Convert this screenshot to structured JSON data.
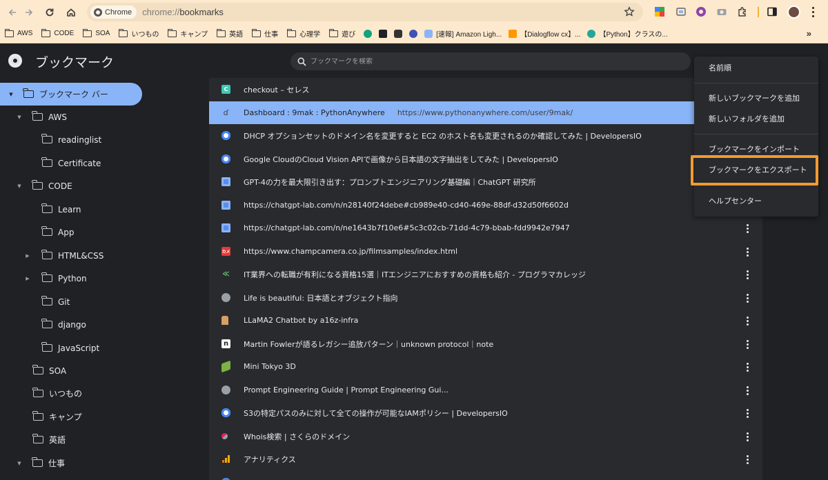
{
  "browser": {
    "chip_label": "Chrome",
    "url_scheme": "chrome://",
    "url_path": "bookmarks"
  },
  "bookmarks_bar": {
    "folders": [
      "AWS",
      "CODE",
      "SOA",
      "いつもの",
      "キャンプ",
      "英語",
      "仕事",
      "心理学",
      "遊び"
    ],
    "links": [
      "[速報] Amazon Ligh...",
      "【Dialogflow cx】...",
      "【Python】クラスの..."
    ],
    "overflow": "»"
  },
  "manager": {
    "title": "ブックマーク",
    "search_placeholder": "ブックマークを検索"
  },
  "sidebar": {
    "items": [
      {
        "label": "ブックマーク バー",
        "arrow": "▼",
        "selected": true
      },
      {
        "label": "AWS",
        "arrow": "▼"
      },
      {
        "label": "readinglist",
        "arrow": ""
      },
      {
        "label": "Certificate",
        "arrow": ""
      },
      {
        "label": "CODE",
        "arrow": "▼"
      },
      {
        "label": "Learn",
        "arrow": ""
      },
      {
        "label": "App",
        "arrow": ""
      },
      {
        "label": "HTML&CSS",
        "arrow": "▶"
      },
      {
        "label": "Python",
        "arrow": "▶"
      },
      {
        "label": "Git",
        "arrow": ""
      },
      {
        "label": "django",
        "arrow": ""
      },
      {
        "label": "JavaScript",
        "arrow": ""
      },
      {
        "label": "SOA",
        "arrow": ""
      },
      {
        "label": "いつもの",
        "arrow": ""
      },
      {
        "label": "キャンプ",
        "arrow": ""
      },
      {
        "label": "英語",
        "arrow": ""
      },
      {
        "label": "仕事",
        "arrow": "▼"
      }
    ]
  },
  "list": {
    "rows": [
      {
        "title": "checkout – セレス",
        "url": "",
        "icon": "C",
        "icon_color": "#3fc8b5",
        "selected": false
      },
      {
        "title": "Dashboard : 9mak : PythonAnywhere",
        "url": "https://www.pythonanywhere.com/user/9mak/",
        "icon": "ɗ",
        "icon_color": "#8ab4f8",
        "selected": true
      },
      {
        "title": "DHCP オプションセットのドメイン名を変更すると EC2 のホスト名も変更されるのか確認してみた | DevelopersIO",
        "url": "",
        "icon": "",
        "icon_color": "#ffffff",
        "selected": false
      },
      {
        "title": "Google CloudのCloud Vision APIで画像から日本語の文字抽出をしてみた | DevelopersIO",
        "url": "",
        "icon": "",
        "icon_color": "#ffffff",
        "selected": false
      },
      {
        "title": "GPT-4の力を最大限引き出す：プロンプトエンジニアリング基礎編｜ChatGPT 研究所",
        "url": "",
        "icon": "",
        "icon_color": "#5b8def",
        "selected": false
      },
      {
        "title": "https://chatgpt-lab.com/n/n28140f24debe#cb989e40-cd40-469e-88df-d32d50f6602d",
        "url": "",
        "icon": "",
        "icon_color": "#5b8def",
        "selected": false
      },
      {
        "title": "https://chatgpt-lab.com/n/ne1643b7f10e6#5c3c02cb-71dd-4c79-bbab-fdd9942e7947",
        "url": "",
        "icon": "",
        "icon_color": "#5b8def",
        "selected": false
      },
      {
        "title": "https://www.champcamera.co.jp/filmsamples/index.html",
        "url": "",
        "icon": "カメ",
        "icon_color": "#e53935",
        "selected": false
      },
      {
        "title": "IT業界への転職が有利になる資格15選｜ITエンジニアにおすすめの資格も紹介 - プログラマカレッジ",
        "url": "",
        "icon": "≪",
        "icon_color": "#2e7d32",
        "selected": false
      },
      {
        "title": "Life is beautiful: 日本語とオブジェクト指向",
        "url": "",
        "icon": "",
        "icon_color": "#9aa0a6",
        "selected": false
      },
      {
        "title": "LLaMA2 Chatbot by a16z-infra",
        "url": "",
        "icon": "",
        "icon_color": "#d9a066",
        "selected": false
      },
      {
        "title": "Martin Fowlerが語るレガシー追放パターン｜unknown protocol｜note",
        "url": "",
        "icon": "n",
        "icon_color": "#ffffff",
        "selected": false
      },
      {
        "title": "Mini Tokyo 3D",
        "url": "",
        "icon": "",
        "icon_color": "#7cb342",
        "selected": false
      },
      {
        "title": "Prompt Engineering Guide | Prompt Engineering Gui...",
        "url": "",
        "icon": "",
        "icon_color": "#9aa0a6",
        "selected": false
      },
      {
        "title": "S3の特定パスのみに対して全ての操作が可能なIAMポリシー | DevelopersIO",
        "url": "",
        "icon": "",
        "icon_color": "#ffffff",
        "selected": false
      },
      {
        "title": "Whois検索 | さくらのドメイン",
        "url": "",
        "icon": "",
        "icon_color": "#e91e63",
        "selected": false
      },
      {
        "title": "アナリティクス",
        "url": "",
        "icon": "",
        "icon_color": "#f9ab00",
        "selected": false
      }
    ]
  },
  "menu": {
    "items": [
      {
        "label": "名前順"
      },
      {
        "label": "新しいブックマークを追加"
      },
      {
        "label": "新しいフォルダを追加"
      },
      {
        "label": "ブックマークをインポート"
      },
      {
        "label": "ブックマークをエクスポート",
        "highlighted": true
      },
      {
        "label": "ヘルプセンター"
      }
    ]
  },
  "colors": {
    "selection": "#8ab4f8",
    "highlight_border": "#f29a33",
    "bar_bg": "#fde9cd",
    "manager_bg": "#202124",
    "list_bg": "#292a2d"
  }
}
